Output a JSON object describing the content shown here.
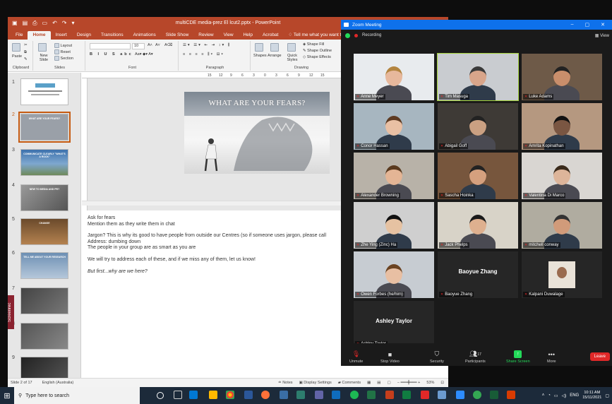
{
  "ppt": {
    "title": "multiCDE media-prez El lcut2.pptx - PowerPoint",
    "tabs": [
      "File",
      "Home",
      "Insert",
      "Design",
      "Transitions",
      "Animations",
      "Slide Show",
      "Review",
      "View",
      "Help",
      "Acrobat"
    ],
    "tell_me": "Tell me what you want to do",
    "ribbon": {
      "paste": "Paste",
      "new_slide": "New Slide",
      "layout": "Layout",
      "reset": "Reset",
      "section": "Section",
      "font_size": "10",
      "shapes": "Shapes",
      "arrange": "Arrange",
      "quick_styles": "Quick Styles",
      "shape_fill": "Shape Fill",
      "shape_outline": "Shape Outline",
      "shape_effects": "Shape Effects",
      "groups": {
        "clipboard": "Clipboard",
        "slides": "Slides",
        "font": "Font",
        "paragraph": "Paragraph",
        "drawing": "Drawing"
      }
    },
    "ruler_ticks": [
      "15",
      "12",
      "9",
      "6",
      "3",
      "0",
      "3",
      "6",
      "9",
      "12",
      "15"
    ],
    "thumbnails": [
      {
        "num": "1",
        "title": "",
        "color": "#ffffff"
      },
      {
        "num": "2",
        "title": "WHAT ARE YOUR FEARS?",
        "color": "#9aa0a8",
        "selected": true
      },
      {
        "num": "3",
        "title": "COMMUNICATE CLEARLY \"WHAT'S A ROCK\"",
        "color": "#4a7fb5"
      },
      {
        "num": "4",
        "title": "NEW TO MEDIA AND PR?",
        "color": "#8a8a8a"
      },
      {
        "num": "5",
        "title": "CHANGE",
        "color": "#a0603a"
      },
      {
        "num": "6",
        "title": "TELL ME ABOUT YOUR RESEARCH",
        "color": "#7a9cc0"
      },
      {
        "num": "7",
        "title": "",
        "color": "#555555"
      },
      {
        "num": "8",
        "title": "",
        "color": "#6a6a6a"
      },
      {
        "num": "9",
        "title": "",
        "color": "#3a3a3a"
      }
    ],
    "slide_title": "WHAT ARE YOUR FEARS?",
    "notes": [
      "Ask for fears",
      "Mention them as they write them in chat",
      "",
      "Jargon? This is why its good to have people from outside our Centres (so if someone uses jargon, please call",
      "Address: dumbing down",
      "The people in your group are as smart as you are",
      "",
      "We will try to address each of these, and if we miss any of them, let us know!",
      "",
      "But first...why are we here?"
    ],
    "status": {
      "slide": "Slide 2 of 17",
      "language": "English (Australia)",
      "notes": "Notes",
      "display_settings": "Display Settings",
      "comments": "Comments",
      "zoom": "53%"
    },
    "screenrec": "Screenrec"
  },
  "zoom": {
    "title": "Zoom Meeting",
    "recording": "Recording",
    "view": "View",
    "participants": [
      {
        "name": "Anne Meyer",
        "bg": "#e8ebee"
      },
      {
        "name": "Tim Masuga",
        "bg": "#c9ccd0",
        "active": true
      },
      {
        "name": "Luke Adams",
        "bg": "#6e5a48"
      },
      {
        "name": "Conor Hassan",
        "bg": "#a7b6c0"
      },
      {
        "name": "Abigail Goff",
        "bg": "#3e3a36"
      },
      {
        "name": "Amrita Kopinathan",
        "bg": "#b59880"
      },
      {
        "name": "Alexander Browning",
        "bg": "#b8b2a8"
      },
      {
        "name": "Sascha Hoinka",
        "bg": "#77563d"
      },
      {
        "name": "Valentina Di Marco",
        "bg": "#d9d6d2"
      },
      {
        "name": "Zhe Ying (Zinc) Ha",
        "bg": "#cfcfcf"
      },
      {
        "name": "Jack Phelps",
        "bg": "#d8d3c8"
      },
      {
        "name": "mitchell conway",
        "bg": "#b0aca0"
      },
      {
        "name": "Owen Forbes (he/him)",
        "bg": "#c7ccd2"
      },
      {
        "name": "Baoyue Zhang",
        "bg": "#262626",
        "big": "Baoyue Zhang"
      },
      {
        "name": "Kalpani Duwalage",
        "bg": "#262626"
      },
      {
        "name": "Ashley Taylor",
        "bg": "#262626",
        "big": "Ashley Taylor"
      }
    ],
    "toolbar": {
      "unmute": "Unmute",
      "stop_video": "Stop Video",
      "security": "Security",
      "participants": "Participants",
      "participants_count": "17",
      "share_screen": "Share Screen",
      "more": "More",
      "leave": "Leave"
    }
  },
  "taskbar": {
    "search_placeholder": "Type here to search",
    "lang": "ENG",
    "time": "10:11 AM",
    "date": "15/11/2021"
  },
  "colors": {
    "ppt_accent": "#b7472a",
    "zoom_blue": "#0e71eb",
    "zoom_green": "#23d959",
    "leave_red": "#e02828"
  }
}
